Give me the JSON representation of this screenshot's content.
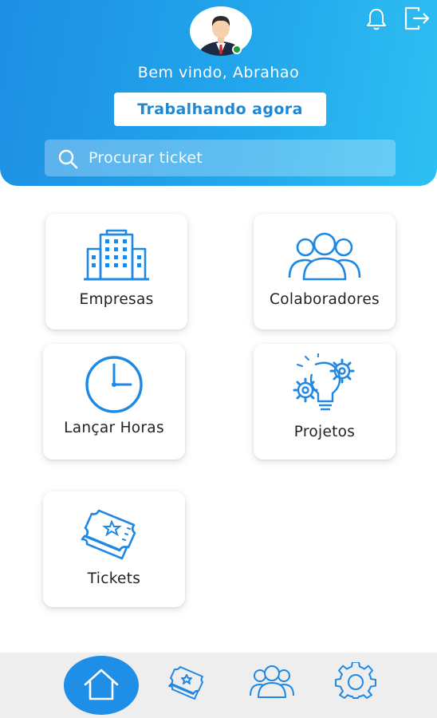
{
  "header": {
    "welcome_text": "Bem vindo, Abrahao",
    "work_button_label": "Trabalhando agora",
    "search_placeholder": "Procurar ticket",
    "colors": {
      "gradient_start": "#1e8fe3",
      "gradient_end": "#2ec0f2",
      "online": "#1f9a3a"
    },
    "icons": [
      "user-avatar",
      "bell-icon",
      "logout-icon",
      "search-icon"
    ]
  },
  "menu": {
    "items": [
      {
        "label": "Empresas",
        "icon": "building-icon"
      },
      {
        "label": "Colaboradores",
        "icon": "users-icon"
      },
      {
        "label": "Lançar Horas",
        "icon": "clock-icon"
      },
      {
        "label": "Projetos",
        "icon": "lightbulb-gears-icon"
      },
      {
        "label": "Tickets",
        "icon": "ticket-icon"
      }
    ],
    "accent_color": "#1e88e5"
  },
  "bottom_nav": {
    "items": [
      {
        "icon": "home-icon",
        "active": true
      },
      {
        "icon": "ticket-icon",
        "active": false
      },
      {
        "icon": "users-icon",
        "active": false
      },
      {
        "icon": "gear-icon",
        "active": false
      }
    ],
    "active_color": "#1e8ee6"
  }
}
